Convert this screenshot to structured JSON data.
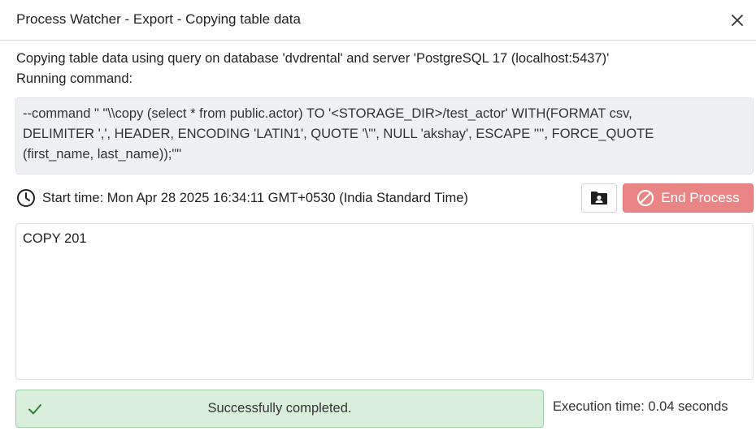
{
  "dialog": {
    "title": "Process Watcher - Export - Copying table data",
    "close_icon": "close-icon"
  },
  "description": {
    "line1": "Copying table data using query on database 'dvdrental' and server 'PostgreSQL 17 (localhost:5437)'",
    "line2": "Running command:"
  },
  "command": {
    "lines": [
      "--command \" \"\\\\copy (select * from public.actor) TO '<STORAGE_DIR>/test_actor' WITH(FORMAT csv,",
      "DELIMITER ',', HEADER, ENCODING 'LATIN1', QUOTE '\\\"', NULL 'akshay', ESCAPE '''', FORCE_QUOTE",
      "(first_name, last_name));\"\""
    ]
  },
  "start": {
    "icon": "clock-icon",
    "text": "Start time: Mon Apr 28 2025 16:34:11 GMT+0530 (India Standard Time)"
  },
  "buttons": {
    "folder_icon": "folder-user-icon",
    "end_process_label": "End Process",
    "end_process_icon": "ban-icon"
  },
  "output": {
    "text": "COPY 201"
  },
  "status": {
    "icon": "check-icon",
    "text": "Successfully completed.",
    "execution_time": "Execution time: 0.04 seconds"
  },
  "colors": {
    "end_button_bg": "#e98585",
    "success_bg": "#d9efdc",
    "success_border": "#9fcea8",
    "command_bg": "#eef0f4"
  }
}
